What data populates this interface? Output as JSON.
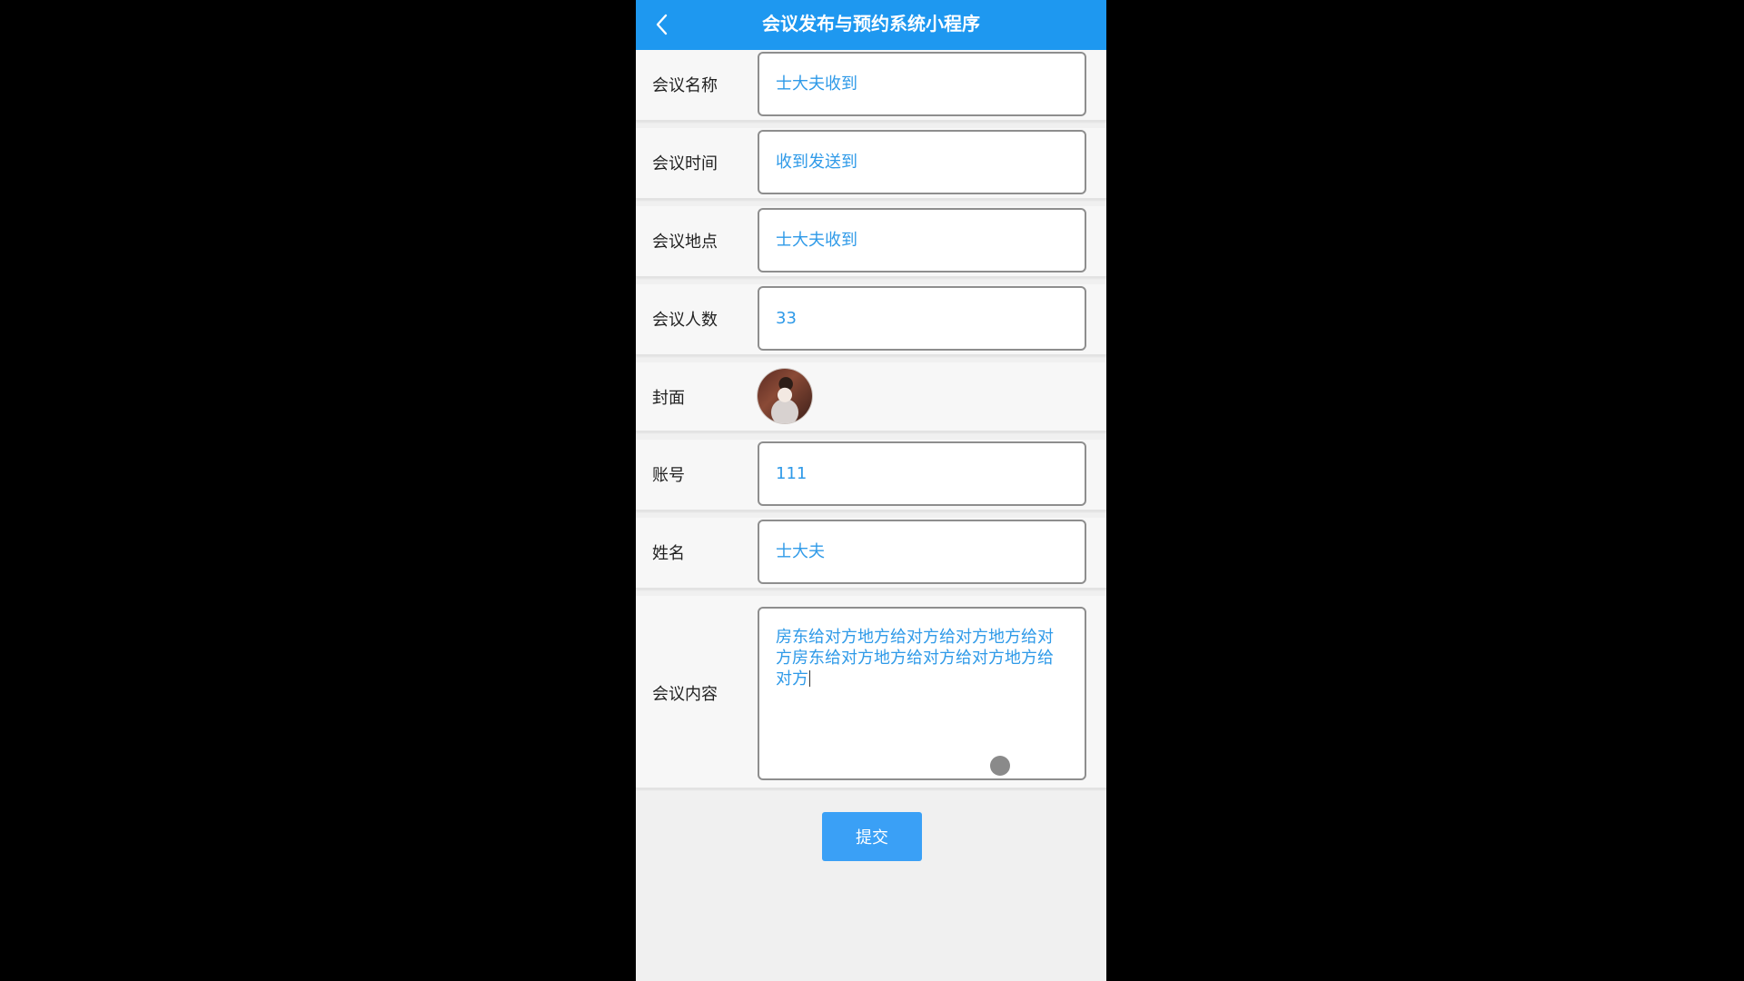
{
  "header": {
    "title": "会议发布与预约系统小程序",
    "back_icon": "chevron-left-icon",
    "color": "#1e98f0"
  },
  "form": {
    "name": {
      "label": "会议名称",
      "value": "士大夫收到"
    },
    "time": {
      "label": "会议时间",
      "value": "收到发送到"
    },
    "location": {
      "label": "会议地点",
      "value": "士大夫收到"
    },
    "count": {
      "label": "会议人数",
      "value": "33"
    },
    "cover": {
      "label": "封面"
    },
    "account": {
      "label": "账号",
      "value": "111"
    },
    "fullname": {
      "label": "姓名",
      "value": "士大夫"
    },
    "content": {
      "label": "会议内容",
      "value": "房东给对方地方给对方给对方地方给对方房东给对方地方给对方给对方地方给对方"
    }
  },
  "submit_label": "提交",
  "colors": {
    "accent": "#1e98f0",
    "input_text": "#2f9ae8",
    "button": "#3aa0f6"
  }
}
